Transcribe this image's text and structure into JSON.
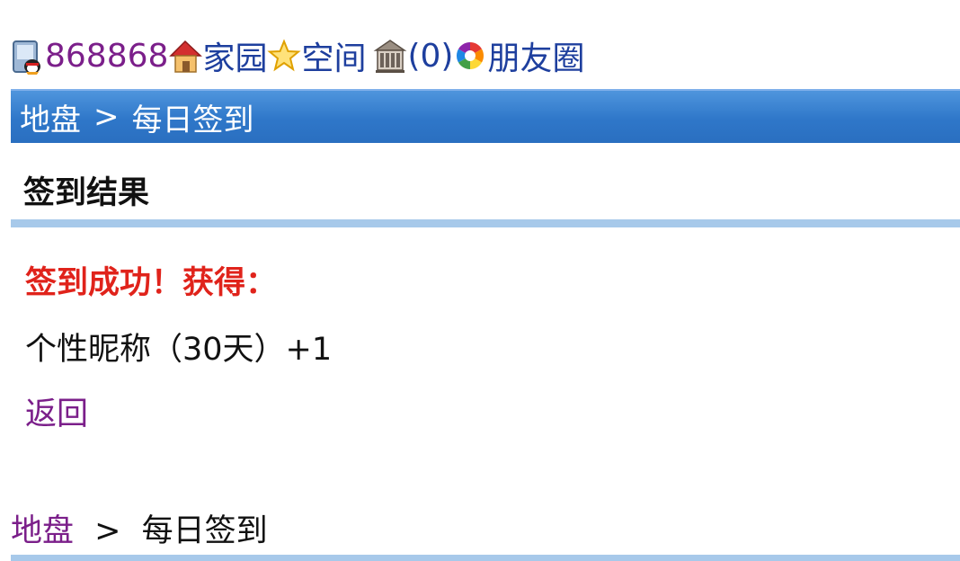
{
  "topnav": {
    "user_id": "868868",
    "home_label": "家园",
    "space_label": "空间",
    "messages_label": "(0)",
    "moments_label": "朋友圈"
  },
  "header_bar": {
    "crumb_link": "地盘",
    "separator": ">",
    "current": "每日签到"
  },
  "content": {
    "section_title": "签到结果",
    "success_text": "签到成功！获得：",
    "reward_text": "个性昵称（30天）+1",
    "back_link": "返回"
  },
  "footer_crumb": {
    "crumb_link": "地盘",
    "separator": ">",
    "current": "每日签到"
  },
  "colors": {
    "header_blue": "#2f77c9",
    "divider_blue": "#a7c9ea",
    "success_red": "#e0231b",
    "link_purple": "#7b1f8a",
    "link_blue": "#1e3f9e"
  },
  "icons": [
    "user-phone-icon",
    "house-icon",
    "star-icon",
    "building-icon",
    "aperture-icon"
  ]
}
